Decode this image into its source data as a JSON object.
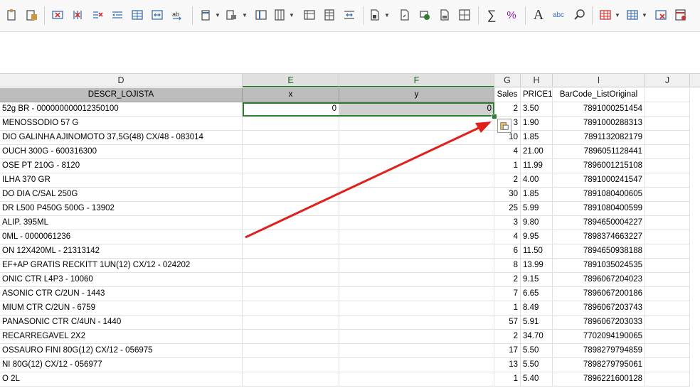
{
  "toolbar": {
    "icons": [
      "paste-icon",
      "paste-special-icon",
      "delete-columns-icon",
      "delete-rows-icon",
      "clear-icon",
      "indent-icon",
      "format-cells-icon",
      "merge-icon",
      "text-wrap-icon",
      "insert-column-icon",
      "insert-row-icon",
      "freeze-icon",
      "table-icon",
      "sort-icon",
      "autofilter-icon",
      "pivot-icon",
      "chart-icon",
      "group-icon",
      "ungroup-icon",
      "outline-icon",
      "border-icon",
      "sum-icon",
      "percent-icon",
      "font-icon",
      "spellcheck-icon",
      "find-icon",
      "conditional-format-icon",
      "styles-icon",
      "clear-format-icon",
      "spreadsheet-icon"
    ],
    "sum_glyph": "∑",
    "percent_glyph": "%",
    "font_glyph": "A",
    "spell_glyph": "abc"
  },
  "columns": [
    {
      "letter": "D",
      "selected": false
    },
    {
      "letter": "E",
      "selected": true
    },
    {
      "letter": "F",
      "selected": true
    },
    {
      "letter": "G",
      "selected": false
    },
    {
      "letter": "H",
      "selected": false
    },
    {
      "letter": "I",
      "selected": false
    },
    {
      "letter": "J",
      "selected": false
    }
  ],
  "header_row": {
    "descr": "DESCR_LOJISTA",
    "x": "x",
    "y": "y",
    "sales": "Sales",
    "price": "PRICE1",
    "barcode": "BarCode_ListOriginal"
  },
  "selection": {
    "e_value": "0",
    "f_value": "0"
  },
  "rows": [
    {
      "descr": "52g BR - 000000000012350100",
      "sales": "2",
      "price": "3.50",
      "barcode": "7891000251454"
    },
    {
      "descr": "MENOSSODIO 57 G",
      "sales": "3",
      "price": "1.90",
      "barcode": "7891000288313"
    },
    {
      "descr": "DIO GALINHA AJINOMOTO 37,5G(48)           CX/48 - 083014",
      "sales": "10",
      "price": "1.85",
      "barcode": "7891132082179"
    },
    {
      "descr": "OUCH 300G - 600316300",
      "sales": "4",
      "price": "21.00",
      "barcode": "7896051128441"
    },
    {
      "descr": "OSE PT 210G - 8120",
      "sales": "1",
      "price": "11.99",
      "barcode": "7896001215108"
    },
    {
      "descr": "ILHA 370 GR",
      "sales": "2",
      "price": "4.00",
      "barcode": "7891000241547"
    },
    {
      "descr": "DO DIA C/SAL 250G",
      "sales": "30",
      "price": "1.85",
      "barcode": "7891080400605"
    },
    {
      "descr": "DR L500 P450G 500G - 13902",
      "sales": "25",
      "price": "5.99",
      "barcode": "7891080400599"
    },
    {
      "descr": "ALIP.  395ML",
      "sales": "3",
      "price": "9.80",
      "barcode": "7894650004227"
    },
    {
      "descr": "0ML - 0000061236",
      "sales": "4",
      "price": "9.95",
      "barcode": "7898374663227"
    },
    {
      "descr": "ON 12X420ML - 21313142",
      "sales": "6",
      "price": "11.50",
      "barcode": "7894650938188"
    },
    {
      "descr": "EF+AP GRATIS RECKITT 1UN(12)           CX/12 - 024202",
      "sales": "8",
      "price": "13.99",
      "barcode": "7891035024535"
    },
    {
      "descr": "ONIC CTR L4P3 - 10060",
      "sales": "2",
      "price": "9.15",
      "barcode": "7896067204023"
    },
    {
      "descr": "ASONIC CTR C/2UN - 1443",
      "sales": "7",
      "price": "6.65",
      "barcode": "7896067200186"
    },
    {
      "descr": "MIUM CTR C/2UN - 6759",
      "sales": "1",
      "price": "8.49",
      "barcode": "7896067203743"
    },
    {
      "descr": "PANASONIC CTR C/4UN - 1440",
      "sales": "57",
      "price": "5.91",
      "barcode": "7896067203033"
    },
    {
      "descr": "RECARREGAVEL 2X2",
      "sales": "2",
      "price": "34.70",
      "barcode": "7702094190065"
    },
    {
      "descr": "OSSAURO FINI 80G(12)           CX/12 - 056975",
      "sales": "17",
      "price": "5.50",
      "barcode": "7898279794859"
    },
    {
      "descr": "NI 80G(12)           CX/12 - 056977",
      "sales": "13",
      "price": "5.50",
      "barcode": "7898279795061"
    },
    {
      "descr": "O 2L",
      "sales": "1",
      "price": "5.40",
      "barcode": "7896221600128"
    }
  ],
  "colors": {
    "selection_border": "#2e7d32",
    "arrow": "#e0201b",
    "header_fill": "#bdbdbd"
  }
}
